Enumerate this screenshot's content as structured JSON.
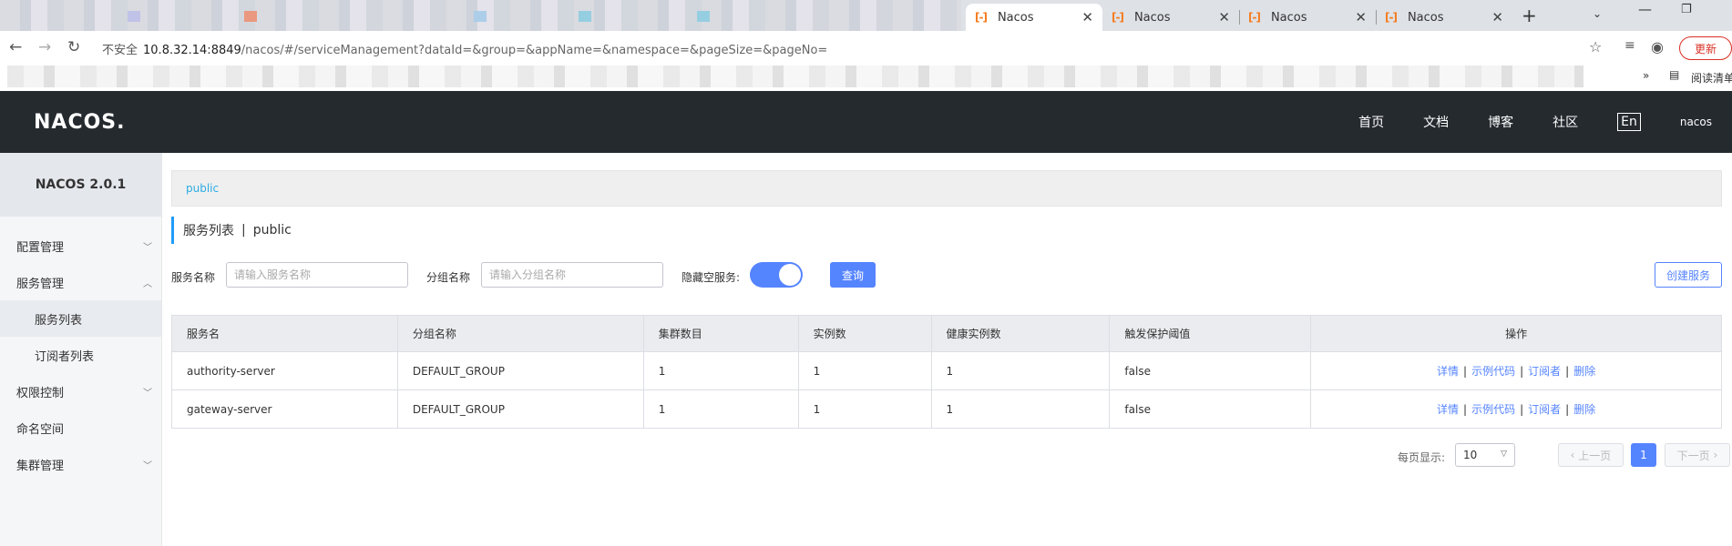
{
  "browser": {
    "tabs": [
      {
        "title": "Nacos",
        "active": true
      },
      {
        "title": "Nacos",
        "active": false
      },
      {
        "title": "Nacos",
        "active": false
      },
      {
        "title": "Nacos",
        "active": false
      }
    ],
    "favicon": "nacos-logo-icon",
    "url_warning": "不安全",
    "url_host": "10.8.32.14:8849",
    "url_path": "/nacos/#/serviceManagement?dataId=&group=&appName=&namespace=&pageSize=&pageNo=",
    "update_label": "更新",
    "reading_list_label": "阅读清单"
  },
  "topnav": {
    "logo": "NACOS.",
    "links": [
      "首页",
      "文档",
      "博客",
      "社区"
    ],
    "lang": "En",
    "user": "nacos"
  },
  "sidebar": {
    "version": "NACOS 2.0.1",
    "items": [
      {
        "label": "配置管理",
        "level": 1,
        "expanded": false
      },
      {
        "label": "服务管理",
        "level": 1,
        "expanded": true
      },
      {
        "label": "服务列表",
        "level": 2,
        "active": true
      },
      {
        "label": "订阅者列表",
        "level": 2
      },
      {
        "label": "权限控制",
        "level": 1,
        "expanded": false
      },
      {
        "label": "命名空间",
        "level": 1
      },
      {
        "label": "集群管理",
        "level": 1,
        "expanded": false
      }
    ]
  },
  "main": {
    "namespace": "public",
    "title": "服务列表",
    "title_ns": "public",
    "filter": {
      "service_label": "服务名称",
      "service_placeholder": "请输入服务名称",
      "group_label": "分组名称",
      "group_placeholder": "请输入分组名称",
      "hide_empty_label": "隐藏空服务:",
      "hide_empty_on": true,
      "query_label": "查询",
      "create_label": "创建服务"
    },
    "table": {
      "headers": [
        "服务名",
        "分组名称",
        "集群数目",
        "实例数",
        "健康实例数",
        "触发保护阈值",
        "操作"
      ],
      "rows": [
        {
          "name": "authority-server",
          "group": "DEFAULT_GROUP",
          "clusters": "1",
          "instances": "1",
          "healthy": "1",
          "protect": "false"
        },
        {
          "name": "gateway-server",
          "group": "DEFAULT_GROUP",
          "clusters": "1",
          "instances": "1",
          "healthy": "1",
          "protect": "false"
        }
      ],
      "ops": [
        "详情",
        "示例代码",
        "订阅者",
        "删除"
      ]
    },
    "pager": {
      "per_page_label": "每页显示:",
      "per_page": "10",
      "prev": "上一页",
      "next": "下一页",
      "current": "1"
    }
  },
  "colors": {
    "accent": "#5584ff",
    "topbar": "#252a2f",
    "namespace": "#2cace2"
  }
}
